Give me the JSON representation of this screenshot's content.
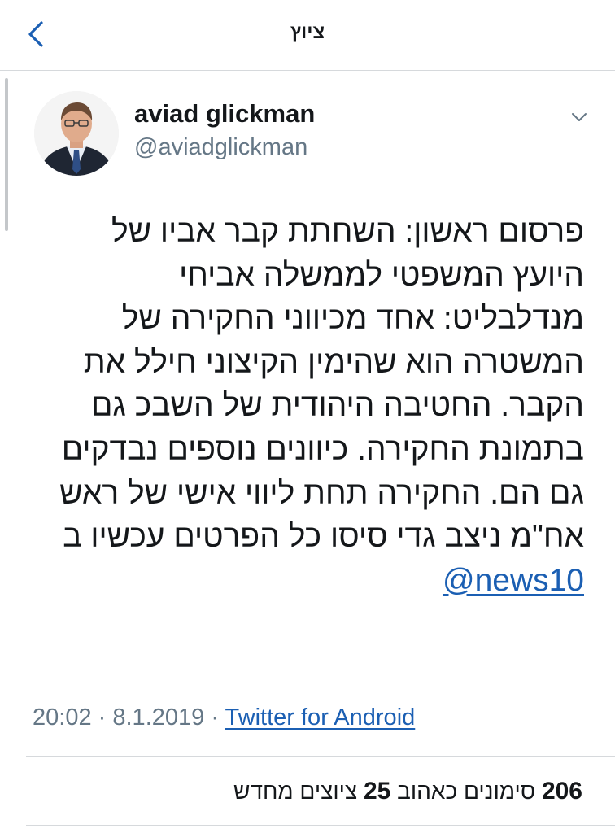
{
  "navbar": {
    "title": "ציוץ",
    "back_icon": "chevron-left-icon"
  },
  "colors": {
    "link_blue": "#1b5fb3",
    "secondary_text": "#657786",
    "primary_text": "#14171a",
    "divider": "#d6d9dc"
  },
  "tweet": {
    "author": {
      "name": "aviad glickman",
      "handle": "@aviadglickman",
      "avatar_icon": "user-avatar"
    },
    "more_icon": "chevron-down-icon",
    "lines": [
      "פרסום ראשון: השחתת קבר אביו של",
      "היועץ המשפטי לממשלה אביחי",
      "מנדלבליט: אחד מכיווני החקירה של",
      "המשטרה הוא שהימין הקיצוני חילל את",
      "הקבר. החטיבה היהודית של השבכ גם",
      "בתמונת החקירה. כיוונים נוספים נבדקים",
      "גם הם. החקירה תחת ליווי אישי של ראש",
      "אח\"מ ניצב גדי סיסו כל הפרטים עכשיו ב"
    ],
    "mention": "@news10",
    "time": "20:02",
    "date": "8.1.2019",
    "separator": "·",
    "source": "Twitter for Android",
    "stats": {
      "retweets_count": "206",
      "retweets_label": "סימונים כאהוב",
      "quotes_count": "25",
      "quotes_label": "ציוצים מחדש"
    }
  }
}
